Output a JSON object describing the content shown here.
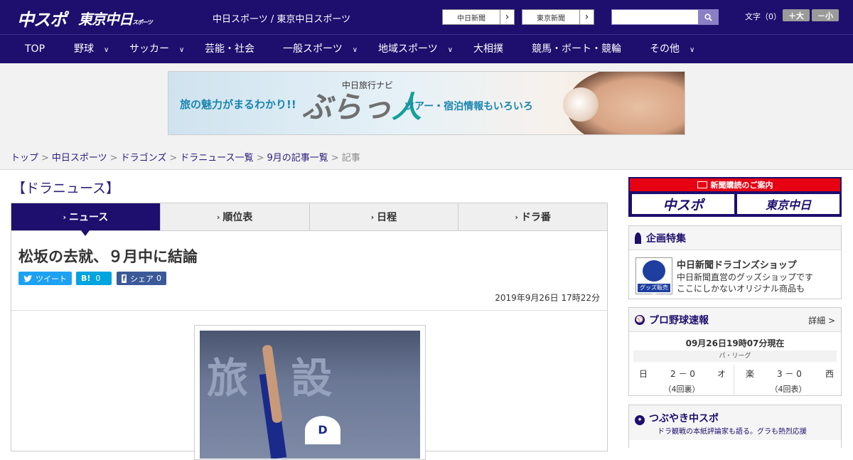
{
  "header": {
    "logo_chuspo": "中スポ",
    "logo_tokyo": "東京中日",
    "logo_tokyo_small": "スポーツ",
    "site_name": "中日スポーツ / 東京中日スポーツ",
    "newspaper_link_1": "中日新聞",
    "newspaper_link_2": "東京新聞",
    "search_placeholder": "",
    "font_size_label": "文字（0）",
    "font_bigger": "＋大",
    "font_smaller": "－小"
  },
  "nav": {
    "items": [
      {
        "label": "TOP"
      },
      {
        "label": "野球"
      },
      {
        "label": "サッカー"
      },
      {
        "label": "芸能・社会"
      },
      {
        "label": "一般スポーツ"
      },
      {
        "label": "地域スポーツ"
      },
      {
        "label": "大相撲"
      },
      {
        "label": "競馬・ボート・競輪"
      },
      {
        "label": "その他"
      }
    ]
  },
  "ad": {
    "left_text": "旅の魅力がまるわかり!!",
    "brand_small": "中日旅行ナビ",
    "brand_large": "ぶらっ",
    "brand_accent": "人",
    "right_text": "ツアー・宿泊情報もいろいろ"
  },
  "breadcrumb": {
    "items": [
      "トップ",
      "中日スポーツ",
      "ドラゴンズ",
      "ドラニュース一覧",
      "9月の記事一覧"
    ],
    "current": "記事"
  },
  "section_title": "【ドラニュース】",
  "tabs": [
    {
      "label": "ニュース"
    },
    {
      "label": "順位表"
    },
    {
      "label": "日程"
    },
    {
      "label": "ドラ番"
    }
  ],
  "article": {
    "headline": "松坂の去就、９月中に結論",
    "share_tweet": "ツイート",
    "share_hatena_icon": "B!",
    "share_hatena_count": "0",
    "share_fb": "シェア",
    "share_fb_count": "0",
    "date": "2019年9月26日 17時22分",
    "photo_cap_letter": "D"
  },
  "sidebar": {
    "subscribe_header": "新聞購読のご案内",
    "subscribe_btn_1": "中スポ",
    "subscribe_btn_2": "東京中日",
    "feature_title": "企画特集",
    "feature_item_title": "中日新聞ドラゴンズショップ",
    "feature_item_desc_1": "中日新聞直営のグッズショップです",
    "feature_item_desc_2": "ここにしかないオリジナル商品も",
    "feature_item_image_label": "グッズ販売中",
    "baseball_title": "プロ野球速報",
    "baseball_more": "詳細 >",
    "baseball_time": "09月26日19時07分現在",
    "baseball_league": "パ・リーグ",
    "games": [
      {
        "home": "日",
        "score": "2 － 0",
        "away": "オ",
        "inning": "（4回裏）"
      },
      {
        "home": "楽",
        "score": "3 － 0",
        "away": "西",
        "inning": "（4回表）"
      }
    ],
    "tweet_title": "つぶやき中スポ",
    "tweet_sub": "ドラ観戦の本紙評論家も語る。グラも熱烈応援"
  },
  "colors": {
    "brand_navy": "#1e0e6e",
    "subscribe_red": "#e60012",
    "twitter": "#1da1f2",
    "hatena": "#00a4de",
    "facebook": "#3b5998"
  }
}
